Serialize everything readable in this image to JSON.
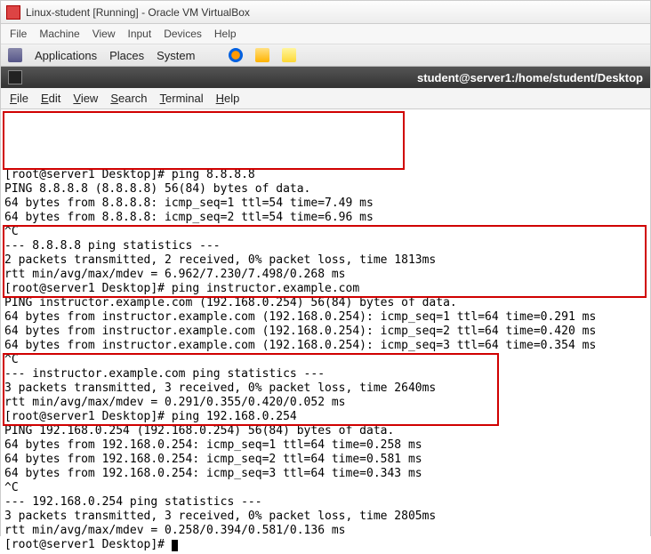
{
  "vbox": {
    "title": "Linux-student [Running] - Oracle VM VirtualBox",
    "menu": [
      "File",
      "Machine",
      "View",
      "Input",
      "Devices",
      "Help"
    ]
  },
  "gnome": {
    "items": [
      "Applications",
      "Places",
      "System"
    ]
  },
  "term_window": {
    "title": "student@server1:/home/student/Desktop",
    "menu": [
      "File",
      "Edit",
      "View",
      "Search",
      "Terminal",
      "Help"
    ]
  },
  "terminal": {
    "prompt": "[root@server1 Desktop]# ",
    "blocks": [
      {
        "cmd": "ping 8.8.8.8",
        "lines": [
          "PING 8.8.8.8 (8.8.8.8) 56(84) bytes of data.",
          "64 bytes from 8.8.8.8: icmp_seq=1 ttl=54 time=7.49 ms",
          "64 bytes from 8.8.8.8: icmp_seq=2 ttl=54 time=6.96 ms",
          "^C",
          "--- 8.8.8.8 ping statistics ---",
          "2 packets transmitted, 2 received, 0% packet loss, time 1813ms",
          "rtt min/avg/max/mdev = 6.962/7.230/7.498/0.268 ms"
        ]
      },
      {
        "cmd": "ping instructor.example.com",
        "lines": [
          "PING instructor.example.com (192.168.0.254) 56(84) bytes of data.",
          "64 bytes from instructor.example.com (192.168.0.254): icmp_seq=1 ttl=64 time=0.291 ms",
          "64 bytes from instructor.example.com (192.168.0.254): icmp_seq=2 ttl=64 time=0.420 ms",
          "64 bytes from instructor.example.com (192.168.0.254): icmp_seq=3 ttl=64 time=0.354 ms",
          "^C",
          "--- instructor.example.com ping statistics ---",
          "3 packets transmitted, 3 received, 0% packet loss, time 2640ms",
          "rtt min/avg/max/mdev = 0.291/0.355/0.420/0.052 ms"
        ]
      },
      {
        "cmd": "ping 192.168.0.254",
        "lines": [
          "PING 192.168.0.254 (192.168.0.254) 56(84) bytes of data.",
          "64 bytes from 192.168.0.254: icmp_seq=1 ttl=64 time=0.258 ms",
          "64 bytes from 192.168.0.254: icmp_seq=2 ttl=64 time=0.581 ms",
          "64 bytes from 192.168.0.254: icmp_seq=3 ttl=64 time=0.343 ms",
          "^C",
          "--- 192.168.0.254 ping statistics ---",
          "3 packets transmitted, 3 received, 0% packet loss, time 2805ms",
          "rtt min/avg/max/mdev = 0.258/0.394/0.581/0.136 ms"
        ]
      }
    ]
  }
}
